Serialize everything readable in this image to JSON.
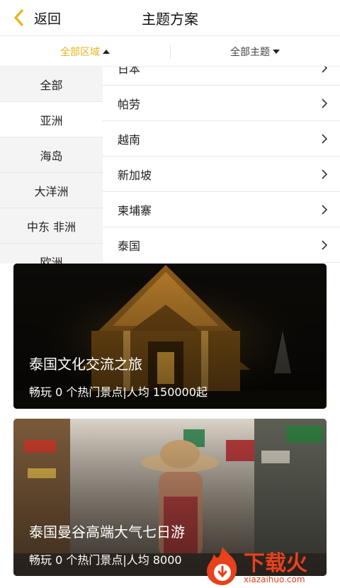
{
  "nav": {
    "back_label": "返回",
    "title": "主题方案"
  },
  "filters": {
    "area": {
      "label": "全部区域",
      "color": "#e9b418"
    },
    "theme": {
      "label": "全部主题"
    }
  },
  "regions": [
    "全部",
    "亚洲",
    "海岛",
    "大洋洲",
    "中东 非洲",
    "欧洲"
  ],
  "selected_region": "亚洲",
  "countries": [
    "日本",
    "帕劳",
    "越南",
    "新加坡",
    "柬埔寨",
    "泰国"
  ],
  "cards": [
    {
      "title": "泰国文化交流之旅",
      "subtitle": "畅玩 0 个热门景点|人均 150000起"
    },
    {
      "title": "泰国曼谷高端大气七日游",
      "subtitle": "畅玩 0 个热门景点|人均 8000"
    }
  ],
  "watermark": {
    "text": "下载火",
    "url": "xiazaihuo.com",
    "color": "#e8411b"
  }
}
